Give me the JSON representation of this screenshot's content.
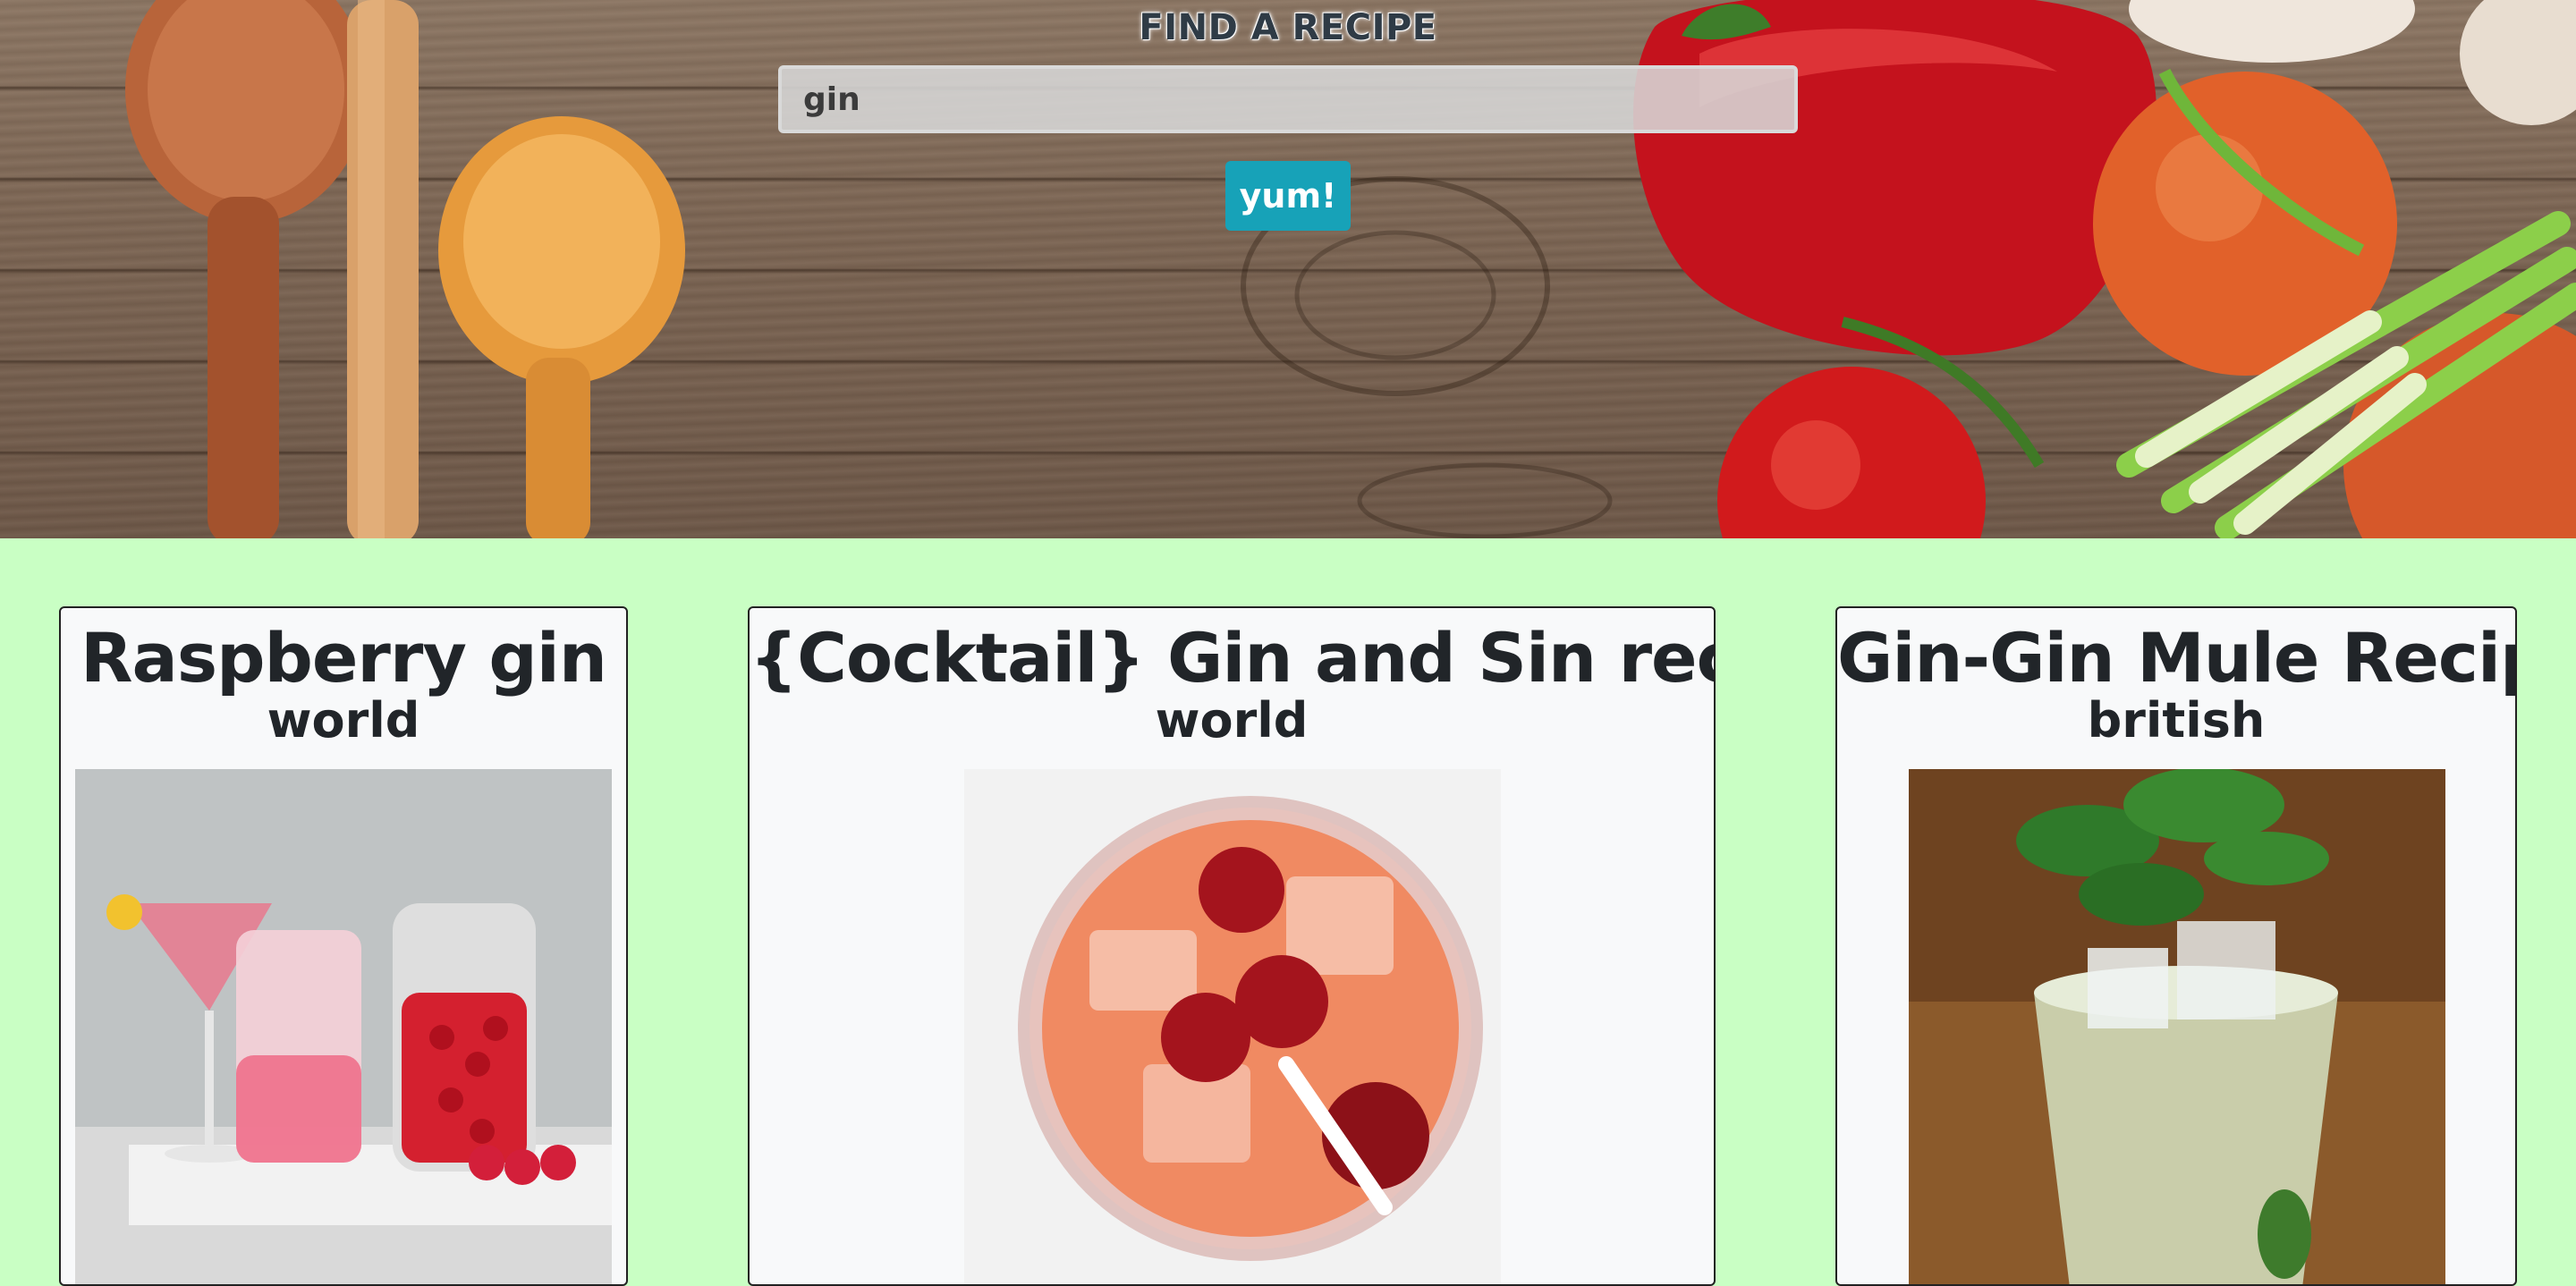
{
  "hero": {
    "title": "FIND A RECIPE",
    "search_value": "gin",
    "button_label": "yum!"
  },
  "colors": {
    "page_background": "#c9ffc4",
    "button": "#17a2b8",
    "card_background": "#f8f9fa"
  },
  "recipes": [
    {
      "title": "Raspberry gin",
      "cuisine": "world",
      "image": "raspberry-gin-cocktail-photo"
    },
    {
      "title": "{Cocktail} Gin and Sin recipes",
      "cuisine": "world",
      "image": "cranberry-cocktail-photo"
    },
    {
      "title": "Gin-Gin Mule Recipe",
      "cuisine": "british",
      "image": "mint-mule-cocktail-photo"
    }
  ]
}
